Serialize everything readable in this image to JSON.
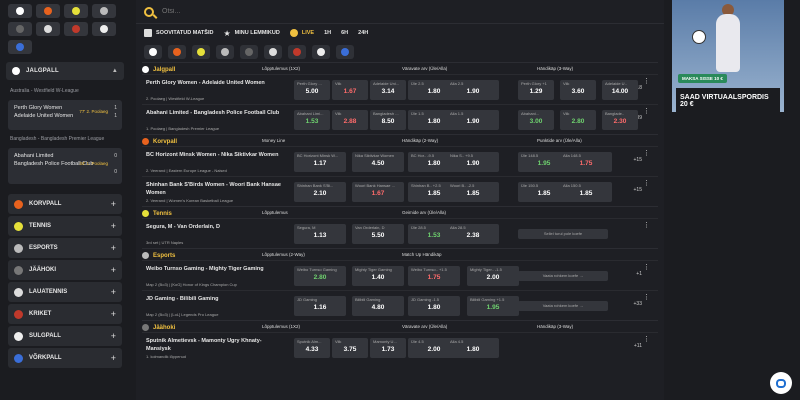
{
  "search": {
    "placeholder": "Otsi..."
  },
  "filters": {
    "upcoming": "SOOVITATUD MATŠID",
    "favorites": "MINU LEMMIKUD",
    "live": "LIVE",
    "h1": "1H",
    "h6": "6H",
    "h24": "24H"
  },
  "sidebar": {
    "football": "JALGPALL",
    "league1": "Australia - Westfield W-League",
    "m1a": "Perth Glory Women",
    "m1b": "Adelaide United Women",
    "m1p": "77' 2. Poolaeg",
    "m1s1": "1",
    "m1s2": "1",
    "league2": "Bangladesh - Bangladesh Premier League",
    "m2a": "Abahani Limited",
    "m2b": "Bangladesh Police Football Club",
    "m2p": "34' 1. Poolaeg",
    "m2s1": "0",
    "m2s2": "0",
    "sports": [
      {
        "label": "KORVPALL"
      },
      {
        "label": "TENNIS"
      },
      {
        "label": "ESPORTS"
      },
      {
        "label": "JÄÄHOKI"
      },
      {
        "label": "LAUATENNIS"
      },
      {
        "label": "KRIKET"
      },
      {
        "label": "SULGPALL"
      },
      {
        "label": "VÕRKPALL"
      }
    ]
  },
  "sections": {
    "football": {
      "title": "Jalgpall",
      "c1": "Lõpptulemus (1X2)",
      "c2": "Väravate arv (Üle/Alla)",
      "c3": "Händikäp (3-Way)"
    },
    "basket": {
      "title": "Korvpall",
      "c1": "Money Line",
      "c2": "Händikäp (2-Way)",
      "c3": "Punktide arv (Üle/Alla)"
    },
    "tennis": {
      "title": "Tennis",
      "c1": "Lõpptulemus",
      "c2": "Geimide arv (Üle/Alla)"
    },
    "esports": {
      "title": "Esports",
      "c1": "Lõpptulemus (2-Way)",
      "c2": "Match Up Händikäp"
    },
    "hockey": {
      "title": "Jäähoki",
      "c1": "Lõpptulemus (1X2)",
      "c2": "Väravate arv (Üle/Alla)",
      "c3": "Händikäp (3-Way)"
    }
  },
  "rows": [
    {
      "title": "Perth Glory Women - Adelaide United Women",
      "meta": "2. Poolaeg  |  Westfield W-League",
      "more": "+18",
      "o": [
        [
          "Perth Glory ...",
          "5.00"
        ],
        [
          "Viik",
          "1.67"
        ],
        [
          "Adelaide Uni...",
          "3.14"
        ],
        [
          "Üle 2.5",
          "1.80"
        ],
        [
          "Alla 2.5",
          "1.90"
        ],
        [
          "Perth Glory +1",
          "1.29"
        ],
        [
          "Viik",
          "3.60"
        ],
        [
          "Adelaide U..",
          "14.00"
        ]
      ]
    },
    {
      "title": "Abahani Limited - Bangladesh Police Football Club",
      "meta": "1. Poolaeg  |  Bangladesh Premier League",
      "more": "+39",
      "o": [
        [
          "Abahani Limi...",
          "1.53"
        ],
        [
          "Viik",
          "2.88"
        ],
        [
          "Bangladesh ...",
          "8.50"
        ],
        [
          "Üle 1.5",
          "1.80"
        ],
        [
          "Alla 1.5",
          "1.90"
        ],
        [
          "Abahani...",
          "3.00"
        ],
        [
          "Viik",
          "2.80"
        ],
        [
          "Banglade..",
          "2.30"
        ]
      ]
    },
    {
      "title": "BC Horizont Minsk Women - Nika Siktivkar Women",
      "meta": "2. Veerand  |  Eastern Europe League - Naised",
      "more": "+15",
      "o": [
        [
          "BC Horizont Minsk W...",
          "1.17"
        ],
        [
          "Nika Siktivkar Women",
          "4.50"
        ],
        [
          "BC Hor.. -9.5",
          "1.80"
        ],
        [
          "Nika S.. +9.5",
          "1.90"
        ],
        [
          "Üle 148.5",
          "1.95"
        ],
        [
          "Alla 148.5",
          "1.75"
        ]
      ]
    },
    {
      "title": "Shinhan Bank S'Birds Women - Woori Bank Hansae Women",
      "meta": "2. Veerand  |  Women's Korean Basketball League",
      "more": "+15",
      "o": [
        [
          "Shinhan Bank S'Bi...",
          "2.10"
        ],
        [
          "Woori Bank Hansae ...",
          "1.67"
        ],
        [
          "Shinhan B.. +2.5",
          "1.85"
        ],
        [
          "Woori B.. -2.5",
          "1.85"
        ],
        [
          "Üle 150.5",
          "1.85"
        ],
        [
          "Alla 150.5",
          "1.85"
        ]
      ]
    },
    {
      "title": "Segura, M - Van Orderlain, D",
      "meta": "3rd set  |  UTR Naples",
      "more": "",
      "o": [
        [
          "Segura, M",
          "1.13"
        ],
        [
          "Van Orderlain, D",
          "5.50"
        ],
        [
          "Üle 28.5",
          "1.53"
        ],
        [
          "Alla 28.5",
          "2.38"
        ]
      ],
      "hint": "Sellel turul pole koefe"
    },
    {
      "title": "Weibo Turnso Gaming - Mighty Tiger Gaming",
      "meta": "Map 2 (Bo3)  |  [KoG] Honor of Kings Champion Cup",
      "more": "+1",
      "o": [
        [
          "Weibo Turnso Gaming",
          "2.80"
        ],
        [
          "Mighty Tiger Gaming",
          "1.40"
        ],
        [
          "Weibo Turnso.. +1.5",
          "1.75"
        ],
        [
          "Mighty Tiger.. -1.5",
          "2.00"
        ]
      ],
      "hint": "Vaata rohkem koefe →"
    },
    {
      "title": "JD Gaming - Bilibili Gaming",
      "meta": "Map 2 (Bo3)  |  [LoL] Legends Pro League",
      "more": "+33",
      "o": [
        [
          "JD Gaming",
          "1.16"
        ],
        [
          "Bilibili Gaming",
          "4.80"
        ],
        [
          "JD Gaming -1.5",
          "1.80"
        ],
        [
          "Bilibili Gaming +1.5",
          "1.95"
        ]
      ],
      "hint": "Vaata rohkem koefe →"
    },
    {
      "title": "Sputnik Almetievsk - Mamonty Ugry Khnaty-Mansiysk",
      "meta": "1. kolmandik lõppenud",
      "more": "+11",
      "o": [
        [
          "Sputnik Alm...",
          "4.33"
        ],
        [
          "Viik",
          "3.75"
        ],
        [
          "Mamonty U...",
          "1.73"
        ],
        [
          "Üle 4.5",
          "2.00"
        ],
        [
          "Alla 4.5",
          "1.80"
        ]
      ]
    }
  ],
  "banner": {
    "pill": "MAKSA SISSE 10 €",
    "text": "SAAD VIRTUAALSPORDIS 20 €"
  }
}
